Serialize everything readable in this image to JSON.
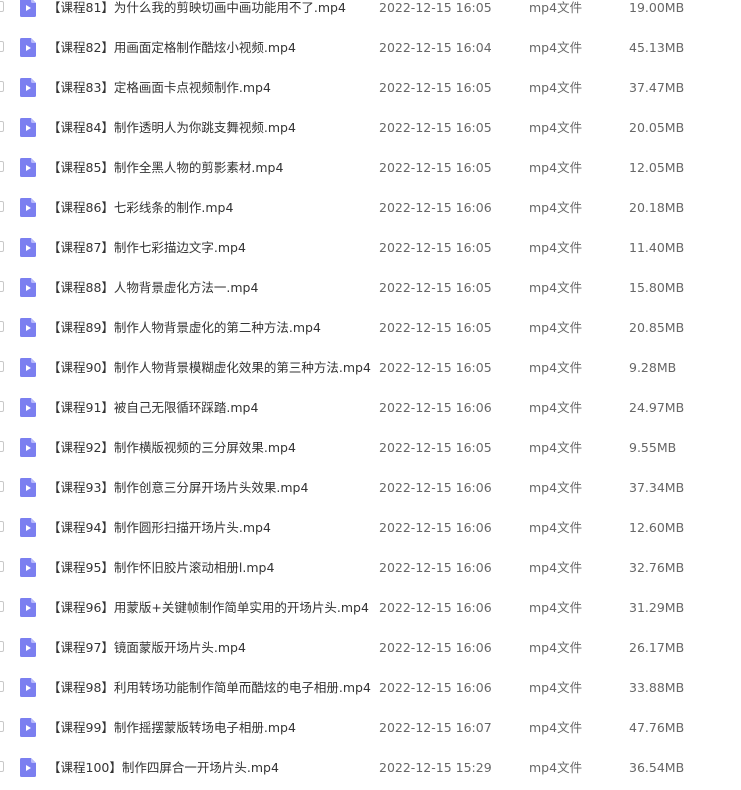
{
  "file_list": {
    "rows": [
      {
        "name": "【课程81】为什么我的剪映切画中画功能用不了.mp4",
        "date": "2022-12-15 16:05",
        "type": "mp4文件",
        "size": "19.00MB"
      },
      {
        "name": "【课程82】用画面定格制作酷炫小视频.mp4",
        "date": "2022-12-15 16:04",
        "type": "mp4文件",
        "size": "45.13MB"
      },
      {
        "name": "【课程83】定格画面卡点视频制作.mp4",
        "date": "2022-12-15 16:05",
        "type": "mp4文件",
        "size": "37.47MB"
      },
      {
        "name": "【课程84】制作透明人为你跳支舞视频.mp4",
        "date": "2022-12-15 16:05",
        "type": "mp4文件",
        "size": "20.05MB"
      },
      {
        "name": "【课程85】制作全黑人物的剪影素材.mp4",
        "date": "2022-12-15 16:05",
        "type": "mp4文件",
        "size": "12.05MB"
      },
      {
        "name": "【课程86】七彩线条的制作.mp4",
        "date": "2022-12-15 16:06",
        "type": "mp4文件",
        "size": "20.18MB"
      },
      {
        "name": "【课程87】制作七彩描边文字.mp4",
        "date": "2022-12-15 16:05",
        "type": "mp4文件",
        "size": "11.40MB"
      },
      {
        "name": "【课程88】人物背景虚化方法一.mp4",
        "date": "2022-12-15 16:05",
        "type": "mp4文件",
        "size": "15.80MB"
      },
      {
        "name": "【课程89】制作人物背景虚化的第二种方法.mp4",
        "date": "2022-12-15 16:05",
        "type": "mp4文件",
        "size": "20.85MB"
      },
      {
        "name": "【课程90】制作人物背景模糊虚化效果的第三种方法.mp4",
        "date": "2022-12-15 16:05",
        "type": "mp4文件",
        "size": "9.28MB"
      },
      {
        "name": "【课程91】被自己无限循环踩踏.mp4",
        "date": "2022-12-15 16:06",
        "type": "mp4文件",
        "size": "24.97MB"
      },
      {
        "name": "【课程92】制作横版视频的三分屏效果.mp4",
        "date": "2022-12-15 16:05",
        "type": "mp4文件",
        "size": "9.55MB"
      },
      {
        "name": "【课程93】制作创意三分屏开场片头效果.mp4",
        "date": "2022-12-15 16:06",
        "type": "mp4文件",
        "size": "37.34MB"
      },
      {
        "name": "【课程94】制作圆形扫描开场片头.mp4",
        "date": "2022-12-15 16:06",
        "type": "mp4文件",
        "size": "12.60MB"
      },
      {
        "name": "【课程95】制作怀旧胶片滚动相册l.mp4",
        "date": "2022-12-15 16:06",
        "type": "mp4文件",
        "size": "32.76MB"
      },
      {
        "name": "【课程96】用蒙版+关键帧制作简单实用的开场片头.mp4",
        "date": "2022-12-15 16:06",
        "type": "mp4文件",
        "size": "31.29MB"
      },
      {
        "name": "【课程97】镜面蒙版开场片头.mp4",
        "date": "2022-12-15 16:06",
        "type": "mp4文件",
        "size": "26.17MB"
      },
      {
        "name": "【课程98】利用转场功能制作简单而酷炫的电子相册.mp4",
        "date": "2022-12-15 16:06",
        "type": "mp4文件",
        "size": "33.88MB"
      },
      {
        "name": "【课程99】制作摇摆蒙版转场电子相册.mp4",
        "date": "2022-12-15 16:07",
        "type": "mp4文件",
        "size": "47.76MB"
      },
      {
        "name": "【课程100】制作四屏合一开场片头.mp4",
        "date": "2022-12-15 15:29",
        "type": "mp4文件",
        "size": "36.54MB"
      }
    ]
  },
  "colors": {
    "video_icon": "#7b7ff0",
    "video_icon_fold": "#b9bcfa"
  }
}
